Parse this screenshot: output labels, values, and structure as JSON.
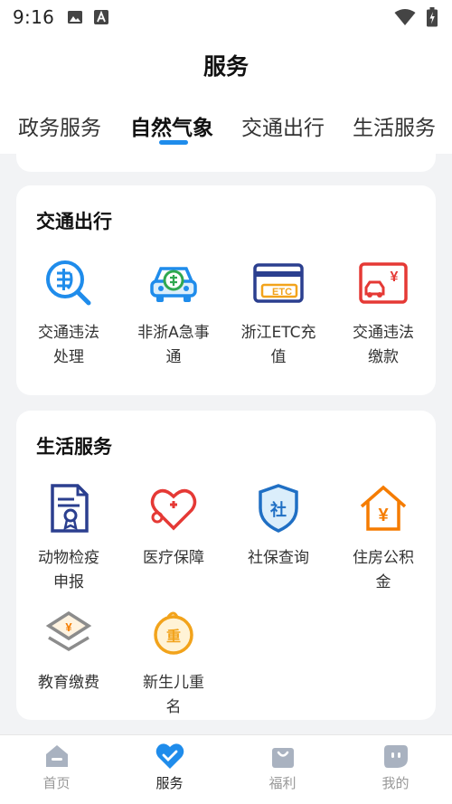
{
  "status_bar": {
    "time": "9:16"
  },
  "header": {
    "title": "服务"
  },
  "tabs": [
    {
      "label": "政务服务"
    },
    {
      "label": "自然气象",
      "active": true
    },
    {
      "label": "交通出行"
    },
    {
      "label": "生活服务"
    }
  ],
  "traffic": {
    "title": "交通出行",
    "items": [
      {
        "label": "交通违法处理",
        "icon": "violation-search-icon"
      },
      {
        "label": "非浙A急事通",
        "icon": "urgent-car-icon"
      },
      {
        "label": "浙江ETC充值",
        "icon": "etc-card-icon"
      },
      {
        "label": "交通违法缴款",
        "icon": "car-payment-icon"
      }
    ]
  },
  "life": {
    "title": "生活服务",
    "items": [
      {
        "label": "动物检疫申报",
        "icon": "certificate-document-icon"
      },
      {
        "label": "医疗保障",
        "icon": "heart-stethoscope-icon"
      },
      {
        "label": "社保查询",
        "icon": "social-security-shield-icon"
      },
      {
        "label": "住房公积金",
        "icon": "house-yuan-icon"
      },
      {
        "label": "教育缴费",
        "icon": "education-payment-icon"
      },
      {
        "label": "新生儿重名",
        "icon": "baby-name-icon"
      }
    ]
  },
  "bottom_nav": [
    {
      "label": "首页",
      "icon": "home-icon"
    },
    {
      "label": "服务",
      "icon": "heart-check-icon",
      "active": true
    },
    {
      "label": "福利",
      "icon": "gift-bag-icon"
    },
    {
      "label": "我的",
      "icon": "profile-face-icon"
    }
  ],
  "colors": {
    "accent": "#1f8ceb",
    "background": "#f2f3f5",
    "red": "#e53935",
    "orange": "#f57c00",
    "navy": "#2b3f8f"
  }
}
